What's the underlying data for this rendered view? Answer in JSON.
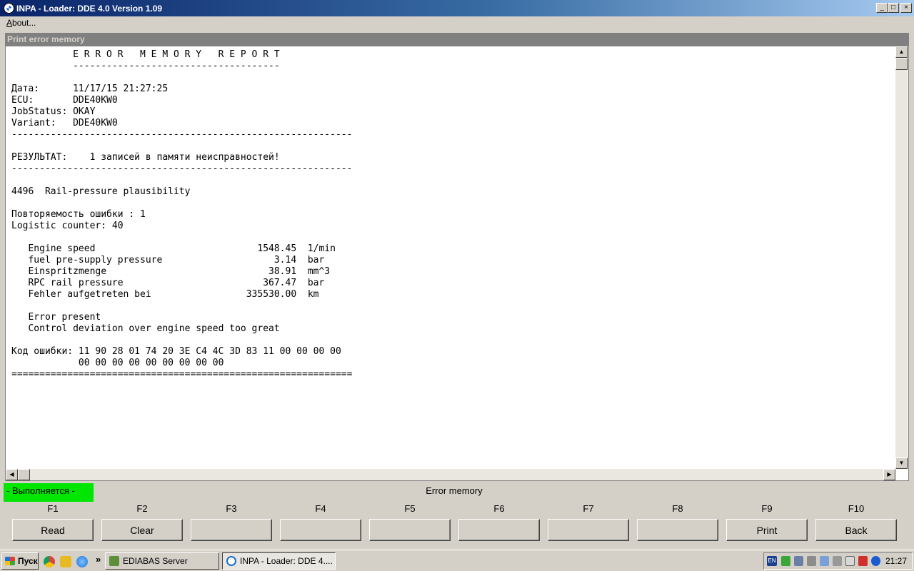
{
  "window": {
    "title": "INPA - Loader:  DDE 4.0 Version 1.09",
    "min_glyph": "_",
    "max_glyph": "□",
    "close_glyph": "×"
  },
  "menu": {
    "about_first": "A",
    "about_rest": "bout..."
  },
  "panel": {
    "title": "Print error memory"
  },
  "report": {
    "lines": [
      "           E R R O R   M E M O R Y   R E P O R T",
      "           -------------------------------------",
      "",
      "Дата:      11/17/15 21:27:25",
      "ECU:       DDE40KW0",
      "JobStatus: OKAY",
      "Variant:   DDE40KW0",
      "-------------------------------------------------------------",
      "",
      "РЕЗУЛЬТАТ:    1 записей в памяти неисправностей!",
      "-------------------------------------------------------------",
      "",
      "4496  Rail-pressure plausibility",
      "",
      "Повторяемость ошибки : 1",
      "Logistic counter: 40",
      "",
      "   Engine speed                             1548.45  1/min",
      "   fuel pre-supply pressure                    3.14  bar",
      "   Einspritzmenge                             38.91  mm^3",
      "   RPC rail pressure                         367.47  bar",
      "   Fehler aufgetreten bei                 335530.00  km",
      "",
      "   Error present",
      "   Control deviation over engine speed too great",
      "",
      "Код ошибки: 11 90 28 01 74 20 3E C4 4C 3D 83 11 00 00 00 00",
      "            00 00 00 00 00 00 00 00 00",
      "============================================================="
    ]
  },
  "status": {
    "running": "- Выполняется -",
    "section": "Error memory"
  },
  "fkeys": [
    {
      "key": "F1",
      "label": "Read"
    },
    {
      "key": "F2",
      "label": "Clear"
    },
    {
      "key": "F3",
      "label": ""
    },
    {
      "key": "F4",
      "label": ""
    },
    {
      "key": "F5",
      "label": ""
    },
    {
      "key": "F6",
      "label": ""
    },
    {
      "key": "F7",
      "label": ""
    },
    {
      "key": "F8",
      "label": ""
    },
    {
      "key": "F9",
      "label": "Print"
    },
    {
      "key": "F10",
      "label": "Back"
    }
  ],
  "taskbar": {
    "start_label": "Пуск",
    "chevron": "»",
    "tasks": [
      {
        "label": "EDIABAS Server",
        "icon": "ediabas-icon",
        "color": "#5b8f3a"
      },
      {
        "label": "INPA - Loader:  DDE 4....",
        "icon": "inpa-icon",
        "color": "#1c6bd0"
      }
    ],
    "lang": "EN",
    "clock": "21:27"
  },
  "colors": {
    "status_green": "#00e600",
    "title_blue": "#0a246a"
  }
}
